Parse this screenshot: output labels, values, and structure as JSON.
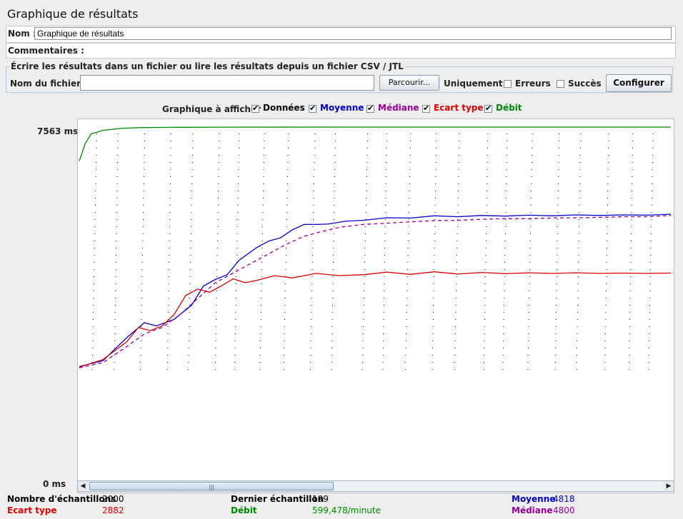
{
  "title": "Graphique de résultats",
  "name_row": {
    "label": "Nom :",
    "value": "Graphique de résultats"
  },
  "comments_row": {
    "label": "Commentaires :"
  },
  "file_section": {
    "legend": "Écrire les résultats dans un fichier ou lire les résultats depuis un fichier CSV / JTL",
    "filename_label": "Nom du fichier :",
    "filename_value": "",
    "browse_label": "Parcourir...",
    "only_label": "Uniquement :",
    "errors_label": "Erreurs",
    "success_label": "Succès",
    "configure_label": "Configurer"
  },
  "display": {
    "label": "Graphique à afficher",
    "items": [
      {
        "label": "Données",
        "color": "#000000",
        "checked": true
      },
      {
        "label": "Moyenne",
        "color": "#0000cc",
        "checked": true
      },
      {
        "label": "Médiane",
        "color": "#990099",
        "checked": true
      },
      {
        "label": "Ecart type",
        "color": "#dd0000",
        "checked": true
      },
      {
        "label": "Débit",
        "color": "#008800",
        "checked": true
      }
    ]
  },
  "axis": {
    "top_label": "7563 ms",
    "bottom_label": "0 ms"
  },
  "stats": {
    "samples_label": "Nombre d'échantillons",
    "samples_value": "2000",
    "last_label": "Dernier échantillon",
    "last_value": "199",
    "avg_label": "Moyenne",
    "avg_value": "4818",
    "std_label": "Ecart type",
    "std_value": "2882",
    "throughput_label": "Débit",
    "throughput_value": "599,478/minute",
    "median_label": "Médiane",
    "median_value": "4800"
  },
  "chart_data": {
    "type": "line",
    "ylim": [
      0,
      7563
    ],
    "series": [
      {
        "name": "Moyenne",
        "color": "#0000cc",
        "values": [
          [
            0,
            80
          ],
          [
            4,
            260
          ],
          [
            8,
            980
          ],
          [
            11,
            1450
          ],
          [
            13,
            1350
          ],
          [
            16,
            1550
          ],
          [
            19,
            2000
          ],
          [
            21,
            2600
          ],
          [
            23,
            2800
          ],
          [
            25,
            2950
          ],
          [
            27,
            3400
          ],
          [
            30,
            3800
          ],
          [
            32,
            4000
          ],
          [
            34,
            4100
          ],
          [
            36,
            4350
          ],
          [
            38,
            4520
          ],
          [
            40,
            4520
          ],
          [
            42,
            4530
          ],
          [
            45,
            4620
          ],
          [
            48,
            4650
          ],
          [
            52,
            4730
          ],
          [
            56,
            4720
          ],
          [
            60,
            4790
          ],
          [
            64,
            4760
          ],
          [
            68,
            4800
          ],
          [
            72,
            4780
          ],
          [
            76,
            4810
          ],
          [
            80,
            4790
          ],
          [
            84,
            4820
          ],
          [
            88,
            4800
          ],
          [
            92,
            4820
          ],
          [
            96,
            4810
          ],
          [
            100,
            4840
          ]
        ]
      },
      {
        "name": "Médiane",
        "color": "#990099",
        "values": [
          [
            0,
            40
          ],
          [
            4,
            200
          ],
          [
            8,
            700
          ],
          [
            11,
            1100
          ],
          [
            14,
            1300
          ],
          [
            17,
            1700
          ],
          [
            20,
            2200
          ],
          [
            23,
            2700
          ],
          [
            26,
            3000
          ],
          [
            29,
            3300
          ],
          [
            32,
            3600
          ],
          [
            35,
            3900
          ],
          [
            38,
            4150
          ],
          [
            41,
            4300
          ],
          [
            44,
            4430
          ],
          [
            48,
            4520
          ],
          [
            52,
            4560
          ],
          [
            56,
            4600
          ],
          [
            60,
            4640
          ],
          [
            64,
            4650
          ],
          [
            68,
            4680
          ],
          [
            72,
            4700
          ],
          [
            76,
            4700
          ],
          [
            80,
            4720
          ],
          [
            84,
            4730
          ],
          [
            88,
            4740
          ],
          [
            92,
            4760
          ],
          [
            96,
            4760
          ],
          [
            100,
            4800
          ]
        ]
      },
      {
        "name": "Ecart type",
        "color": "#dd0000",
        "values": [
          [
            0,
            60
          ],
          [
            4,
            300
          ],
          [
            8,
            850
          ],
          [
            10,
            1300
          ],
          [
            12,
            1200
          ],
          [
            14,
            1350
          ],
          [
            16,
            1700
          ],
          [
            18,
            2300
          ],
          [
            20,
            2500
          ],
          [
            22,
            2400
          ],
          [
            24,
            2600
          ],
          [
            26,
            2820
          ],
          [
            28,
            2700
          ],
          [
            30,
            2770
          ],
          [
            33,
            2920
          ],
          [
            36,
            2850
          ],
          [
            40,
            2990
          ],
          [
            44,
            2920
          ],
          [
            48,
            2950
          ],
          [
            52,
            3030
          ],
          [
            56,
            2960
          ],
          [
            60,
            3040
          ],
          [
            64,
            2970
          ],
          [
            68,
            3020
          ],
          [
            72,
            2980
          ],
          [
            76,
            3010
          ],
          [
            80,
            2990
          ],
          [
            84,
            3010
          ],
          [
            88,
            2990
          ],
          [
            92,
            3000
          ],
          [
            96,
            2990
          ],
          [
            100,
            3000
          ]
        ]
      },
      {
        "name": "Débit",
        "color": "#008800",
        "values": [
          [
            0,
            6500
          ],
          [
            1,
            7050
          ],
          [
            2,
            7350
          ],
          [
            4,
            7460
          ],
          [
            7,
            7520
          ],
          [
            10,
            7545
          ],
          [
            15,
            7555
          ],
          [
            25,
            7560
          ],
          [
            50,
            7563
          ],
          [
            100,
            7563
          ]
        ]
      }
    ]
  }
}
